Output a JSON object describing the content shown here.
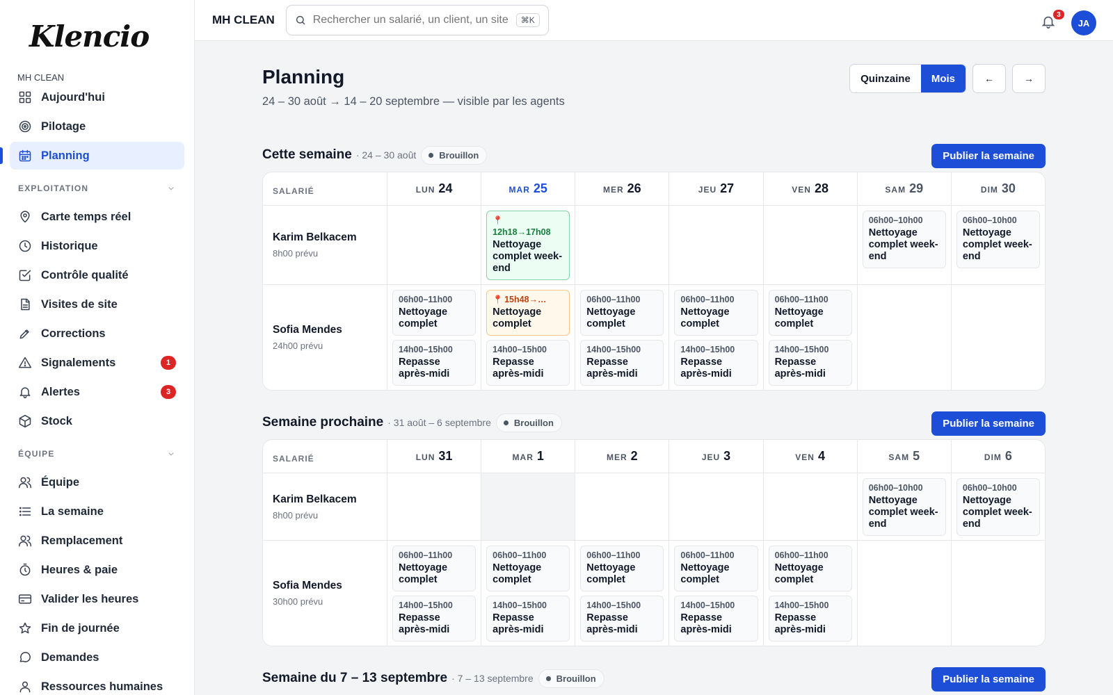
{
  "sidebar": {
    "logo": "Klencio",
    "org": "MH CLEAN",
    "top_items": [
      {
        "label": "Aujourd'hui",
        "icon": "grid-icon"
      },
      {
        "label": "Pilotage",
        "icon": "target-icon"
      },
      {
        "label": "Planning",
        "icon": "calendar-icon",
        "active": true
      }
    ],
    "sections": [
      {
        "title": "EXPLOITATION",
        "items": [
          {
            "label": "Carte temps réel",
            "icon": "map-pin-icon"
          },
          {
            "label": "Historique",
            "icon": "clock-icon"
          },
          {
            "label": "Contrôle qualité",
            "icon": "check-square-icon"
          },
          {
            "label": "Visites de site",
            "icon": "document-icon"
          },
          {
            "label": "Corrections",
            "icon": "pen-icon"
          },
          {
            "label": "Signalements",
            "icon": "warning-icon",
            "badge": "1"
          },
          {
            "label": "Alertes",
            "icon": "bell-icon",
            "badge": "3"
          },
          {
            "label": "Stock",
            "icon": "box-icon"
          }
        ]
      },
      {
        "title": "ÉQUIPE",
        "items": [
          {
            "label": "Équipe",
            "icon": "users-icon"
          },
          {
            "label": "La semaine",
            "icon": "list-icon"
          },
          {
            "label": "Remplacement",
            "icon": "user-swap-icon"
          },
          {
            "label": "Heures & paie",
            "icon": "stopwatch-icon"
          },
          {
            "label": "Valider les heures",
            "icon": "card-icon"
          },
          {
            "label": "Fin de journée",
            "icon": "star-icon"
          },
          {
            "label": "Demandes",
            "icon": "chat-icon"
          },
          {
            "label": "Ressources humaines",
            "icon": "user-icon"
          }
        ]
      }
    ]
  },
  "topbar": {
    "brand": "MH CLEAN",
    "search_placeholder": "Rechercher un salarié, un client, un site…",
    "shortcut": "⌘K",
    "notif_count": "3",
    "avatar": "JA"
  },
  "page": {
    "title": "Planning",
    "subtitle": "24 – 30 août → 14 – 20 septembre — visible par les agents",
    "view_options": [
      "Quinzaine",
      "Mois"
    ],
    "active_view": "Mois",
    "prev": "←",
    "next": "→",
    "publish_label": "Publier la semaine",
    "employee_header": "SALARIÉ",
    "draft_label": "Brouillon"
  },
  "weeks": [
    {
      "title": "Cette semaine",
      "range": "· 24 – 30 août",
      "days": [
        {
          "dw": "LUN",
          "dn": "24"
        },
        {
          "dw": "MAR",
          "dn": "25",
          "today": true
        },
        {
          "dw": "MER",
          "dn": "26"
        },
        {
          "dw": "JEU",
          "dn": "27"
        },
        {
          "dw": "VEN",
          "dn": "28"
        },
        {
          "dw": "SAM",
          "dn": "29",
          "weekend": true
        },
        {
          "dw": "DIM",
          "dn": "30",
          "weekend": true
        }
      ],
      "rows": [
        {
          "name": "Karim Belkacem",
          "planned": "8h00 prévu",
          "row_height": 112,
          "cells": [
            [],
            [
              {
                "time": "12h18→17h08",
                "name": "Nettoyage complet week-end",
                "style": "green",
                "pin": true
              }
            ],
            [],
            [],
            [],
            [
              {
                "time": "06h00–10h00",
                "name": "Nettoyage complet week-end"
              }
            ],
            [
              {
                "time": "06h00–10h00",
                "name": "Nettoyage complet week-end"
              }
            ]
          ]
        },
        {
          "name": "Sofia Mendes",
          "planned": "24h00 prévu",
          "row_height": 146,
          "cells": [
            [
              {
                "time": "06h00–11h00",
                "name": "Nettoyage complet"
              },
              {
                "time": "14h00–15h00",
                "name": "Repasse après-midi"
              }
            ],
            [
              {
                "time": "15h48→…",
                "name": "Nettoyage complet",
                "style": "orange",
                "pin": true,
                "inline": true
              },
              {
                "time": "14h00–15h00",
                "name": "Repasse après-midi"
              }
            ],
            [
              {
                "time": "06h00–11h00",
                "name": "Nettoyage complet"
              },
              {
                "time": "14h00–15h00",
                "name": "Repasse après-midi"
              }
            ],
            [
              {
                "time": "06h00–11h00",
                "name": "Nettoyage complet"
              },
              {
                "time": "14h00–15h00",
                "name": "Repasse après-midi"
              }
            ],
            [
              {
                "time": "06h00–11h00",
                "name": "Nettoyage complet"
              },
              {
                "time": "14h00–15h00",
                "name": "Repasse après-midi"
              }
            ],
            [],
            []
          ]
        }
      ]
    },
    {
      "title": "Semaine prochaine",
      "range": "· 31 août – 6 septembre",
      "days": [
        {
          "dw": "LUN",
          "dn": "31"
        },
        {
          "dw": "MAR",
          "dn": "1"
        },
        {
          "dw": "MER",
          "dn": "2"
        },
        {
          "dw": "JEU",
          "dn": "3"
        },
        {
          "dw": "VEN",
          "dn": "4"
        },
        {
          "dw": "SAM",
          "dn": "5",
          "weekend": true
        },
        {
          "dw": "DIM",
          "dn": "6",
          "weekend": true
        }
      ],
      "rows": [
        {
          "name": "Karim Belkacem",
          "planned": "8h00 prévu",
          "row_height": 96,
          "grey_cols": [
            1
          ],
          "cells": [
            [],
            [],
            [],
            [],
            [],
            [
              {
                "time": "06h00–10h00",
                "name": "Nettoyage complet week-end"
              }
            ],
            [
              {
                "time": "06h00–10h00",
                "name": "Nettoyage complet week-end"
              }
            ]
          ]
        },
        {
          "name": "Sofia Mendes",
          "planned": "30h00 prévu",
          "row_height": 146,
          "cells": [
            [
              {
                "time": "06h00–11h00",
                "name": "Nettoyage complet"
              },
              {
                "time": "14h00–15h00",
                "name": "Repasse après-midi"
              }
            ],
            [
              {
                "time": "06h00–11h00",
                "name": "Nettoyage complet"
              },
              {
                "time": "14h00–15h00",
                "name": "Repasse après-midi"
              }
            ],
            [
              {
                "time": "06h00–11h00",
                "name": "Nettoyage complet"
              },
              {
                "time": "14h00–15h00",
                "name": "Repasse après-midi"
              }
            ],
            [
              {
                "time": "06h00–11h00",
                "name": "Nettoyage complet"
              },
              {
                "time": "14h00–15h00",
                "name": "Repasse après-midi"
              }
            ],
            [
              {
                "time": "06h00–11h00",
                "name": "Nettoyage complet"
              },
              {
                "time": "14h00–15h00",
                "name": "Repasse après-midi"
              }
            ],
            [],
            []
          ]
        }
      ]
    },
    {
      "title": "Semaine du 7 – 13 septembre",
      "range": "· 7 – 13 septembre",
      "days": [],
      "rows": []
    }
  ]
}
